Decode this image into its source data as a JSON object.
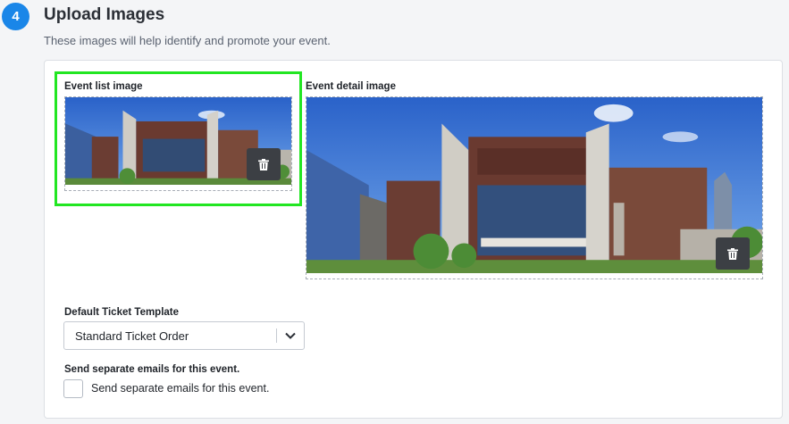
{
  "step": {
    "number": "4",
    "title": "Upload Images",
    "subtitle": "These images will help identify and promote your event."
  },
  "images": {
    "list_label": "Event list image",
    "detail_label": "Event detail image"
  },
  "ticket_template": {
    "label": "Default Ticket Template",
    "selected": "Standard Ticket Order"
  },
  "emails": {
    "heading": "Send separate emails for this event.",
    "checkbox_label": "Send separate emails for this event.",
    "checked": false
  },
  "icons": {
    "delete": "trash-icon",
    "dropdown": "chevron-down-icon"
  },
  "colors": {
    "accent": "#1a86e8",
    "highlight": "#22e622",
    "button_dark": "#3c3f44"
  }
}
